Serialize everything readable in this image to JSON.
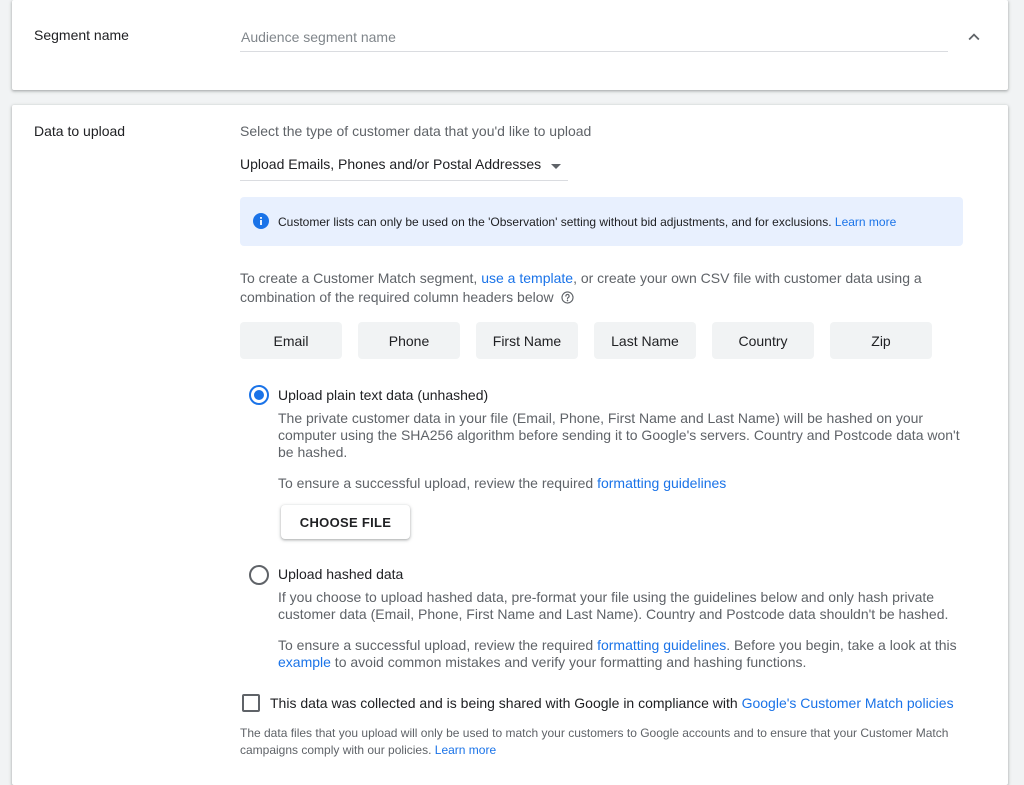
{
  "segment": {
    "label": "Segment name",
    "placeholder": "Audience segment name",
    "value": ""
  },
  "upload": {
    "label": "Data to upload",
    "prompt": "Select the type of customer data that you'd like to upload",
    "type_selected": "Upload Emails, Phones and/or Postal Addresses",
    "banner": {
      "icon": "info-icon",
      "text": "Customer lists can only be used on the 'Observation' setting without bid adjustments, and for exclusions.",
      "link": "Learn more"
    },
    "intro": {
      "part1": "To create a Customer Match segment,",
      "template_link": "use a template",
      "part2": ", or create your own CSV file with customer data using a",
      "line2": "combination of the required column headers below"
    },
    "headers": [
      "Email",
      "Phone",
      "First Name",
      "Last Name",
      "Country",
      "Zip"
    ],
    "options": [
      {
        "title": "Upload plain text data (unhashed)",
        "selected": true,
        "desc_lines": [
          "The private customer data in your file (Email, Phone, First Name and Last Name) will be hashed on your",
          "computer using the SHA256 algorithm before sending it to Google's servers. Country and Postcode data won't",
          "be hashed."
        ],
        "ensure_text": "To ensure a successful upload, review the required",
        "ensure_link": "formatting guidelines",
        "button": "CHOOSE FILE"
      },
      {
        "title": "Upload hashed data",
        "selected": false,
        "desc_lines": [
          "If you choose to upload hashed data, pre-format your file using the guidelines below and only hash private",
          "customer data (Email, Phone, First Name and Last Name). Country and Postcode data shouldn't be hashed."
        ],
        "ensure_text": "To ensure a successful upload, review the required",
        "ensure_link": "formatting guidelines",
        "ensure_after": ". Before you begin, take a look at this",
        "example_link": "example",
        "ensure_tail": " to avoid common mistakes and verify your formatting and hashing functions."
      }
    ],
    "consent": {
      "checked": false,
      "text": "This data was collected and is being shared with Google in compliance with",
      "link": "Google's Customer Match policies"
    },
    "footer": {
      "line1": "The data files that you upload will only be used to match your customers to Google accounts and to ensure that your Customer Match",
      "line2": "campaigns comply with our policies.",
      "link": "Learn more"
    }
  },
  "colors": {
    "accent": "#1a73e8",
    "banner_bg": "#e8f0fe",
    "chip_bg": "#f1f3f4"
  }
}
